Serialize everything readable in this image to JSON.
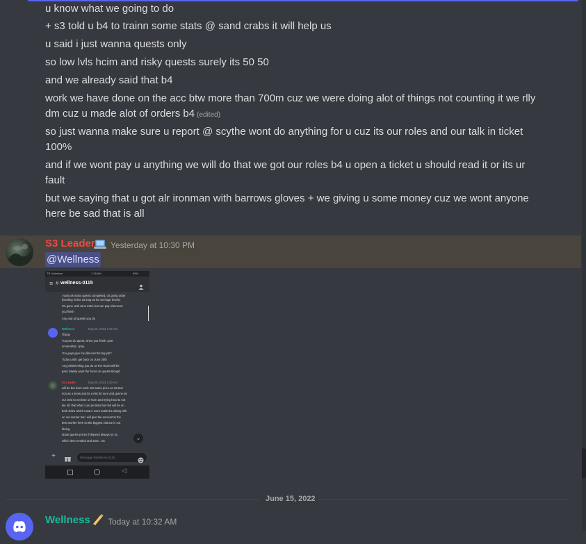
{
  "messages_top": [
    {
      "text": "u know what we going to do"
    },
    {
      "text": "+ s3 told u b4 to trainn some stats @ sand crabs it will help us"
    },
    {
      "text": "u said i just wanna quests only"
    },
    {
      "text": "so low lvls hcim and risky quests surely its 50 50"
    },
    {
      "text": "and we already said that b4"
    },
    {
      "text": "work we have done on the acc btw more than 700m cuz we were doing alot of things not counting it  we rlly"
    },
    {
      "text": "dm cuz u made alot of orders b4",
      "edited": "(edited)"
    },
    {
      "text": "so just wanna make sure u report @ scythe wont do anything for u cuz its our roles and our talk in ticket"
    },
    {
      "text": "100%"
    },
    {
      "text": "and if we wont pay u anything we will do that we got our roles b4 u open a ticket u should read it or its ur"
    },
    {
      "text": "fault"
    },
    {
      "text": "but we saying that u got alr ironman with barrows gloves + we giving u some money cuz we wont anyone"
    },
    {
      "text": "here be sad that is all"
    }
  ],
  "s3_message": {
    "username": "S3 Leader",
    "user_color": "#f04747",
    "timestamp": "Yesterday at 10:30 PM",
    "mention": "@Wellness",
    "highlight_color": "#49443c"
  },
  "screenshot": {
    "status_left": "TR Vodafone",
    "status_time": "7:28 AM",
    "status_right": "99%",
    "channel": "wellness-0115",
    "lines_a": [
      "I want as many quests completed, on going order",
      "(leveling is fine as long as its not huge levels)",
      "I'm gone until June 23rd, but can pay whenever",
      "you finish",
      "Any and all quests you do"
    ],
    "wellness_name": "Wellness",
    "wellness_ts": "May 25, 2022 1:35 AM",
    "lines_b": [
      "I'll pay",
      "You just do quest, when you finish, post",
      "screenshot, I pay.",
      "You guys give me discount for big job?",
      "Today until I get back on June 25th",
      "Any jobs/leveling you do on the HCIM will be",
      "paid. Mainly want the focus on quests though"
    ],
    "s3_name": "S3 Leader",
    "s3_ts": "May 25, 2022 1:39 AM",
    "lines_c": [
      "will do but hcim work isnt same price as normal",
      "iron as u know and its a risk for sure and gonne do",
      "our best to not lose ur hcim and trying hard to not",
      "die ofc that what i can promiss but risk will be on",
      "both sides which mean i wont make the dieing risk",
      "on our worker but i will give the account to the",
      "best worker here so the biggest chance is not",
      "dieing",
      "about quests prices if depend always on st...",
      "which item needed and stam ..etc"
    ],
    "input_placeholder": "Message #wellness-0115"
  },
  "date_divider": "June 15, 2022",
  "wellness_message": {
    "username": "Wellness",
    "user_color": "#1abc9c",
    "timestamp": "Today at 10:32 AM"
  }
}
